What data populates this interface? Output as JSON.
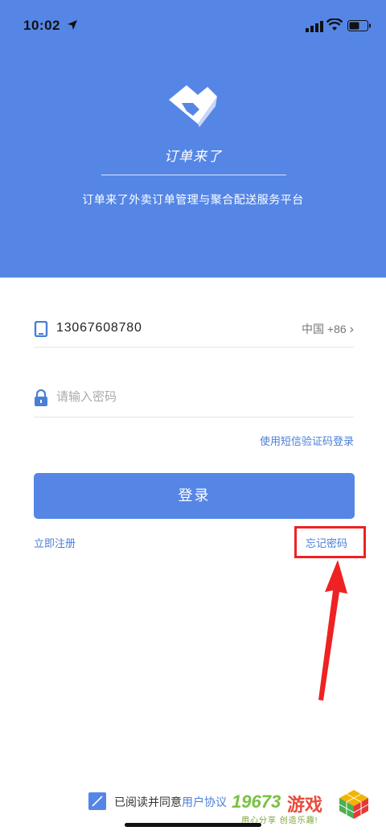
{
  "status_bar": {
    "time": "10:02"
  },
  "header": {
    "app_name": "订单来了",
    "slogan": "订单来了外卖订单管理与聚合配送服务平台"
  },
  "login_form": {
    "phone_value": "13067608780",
    "region_label": "中国 +86",
    "password_placeholder": "请输入密码",
    "code_login_link": "使用短信验证码登录",
    "login_button": "登录",
    "register_link": "立即注册",
    "forgot_link": "忘记密码"
  },
  "agreement": {
    "text": "已阅读并同意",
    "link": "用户协议"
  },
  "watermark": {
    "number": "19673",
    "word": "游戏",
    "tagline": "用心分享 创造乐趣!"
  },
  "colors": {
    "brand_blue": "#5586e6",
    "link_blue": "#4a7fd9",
    "highlight_red": "#ee2222"
  }
}
